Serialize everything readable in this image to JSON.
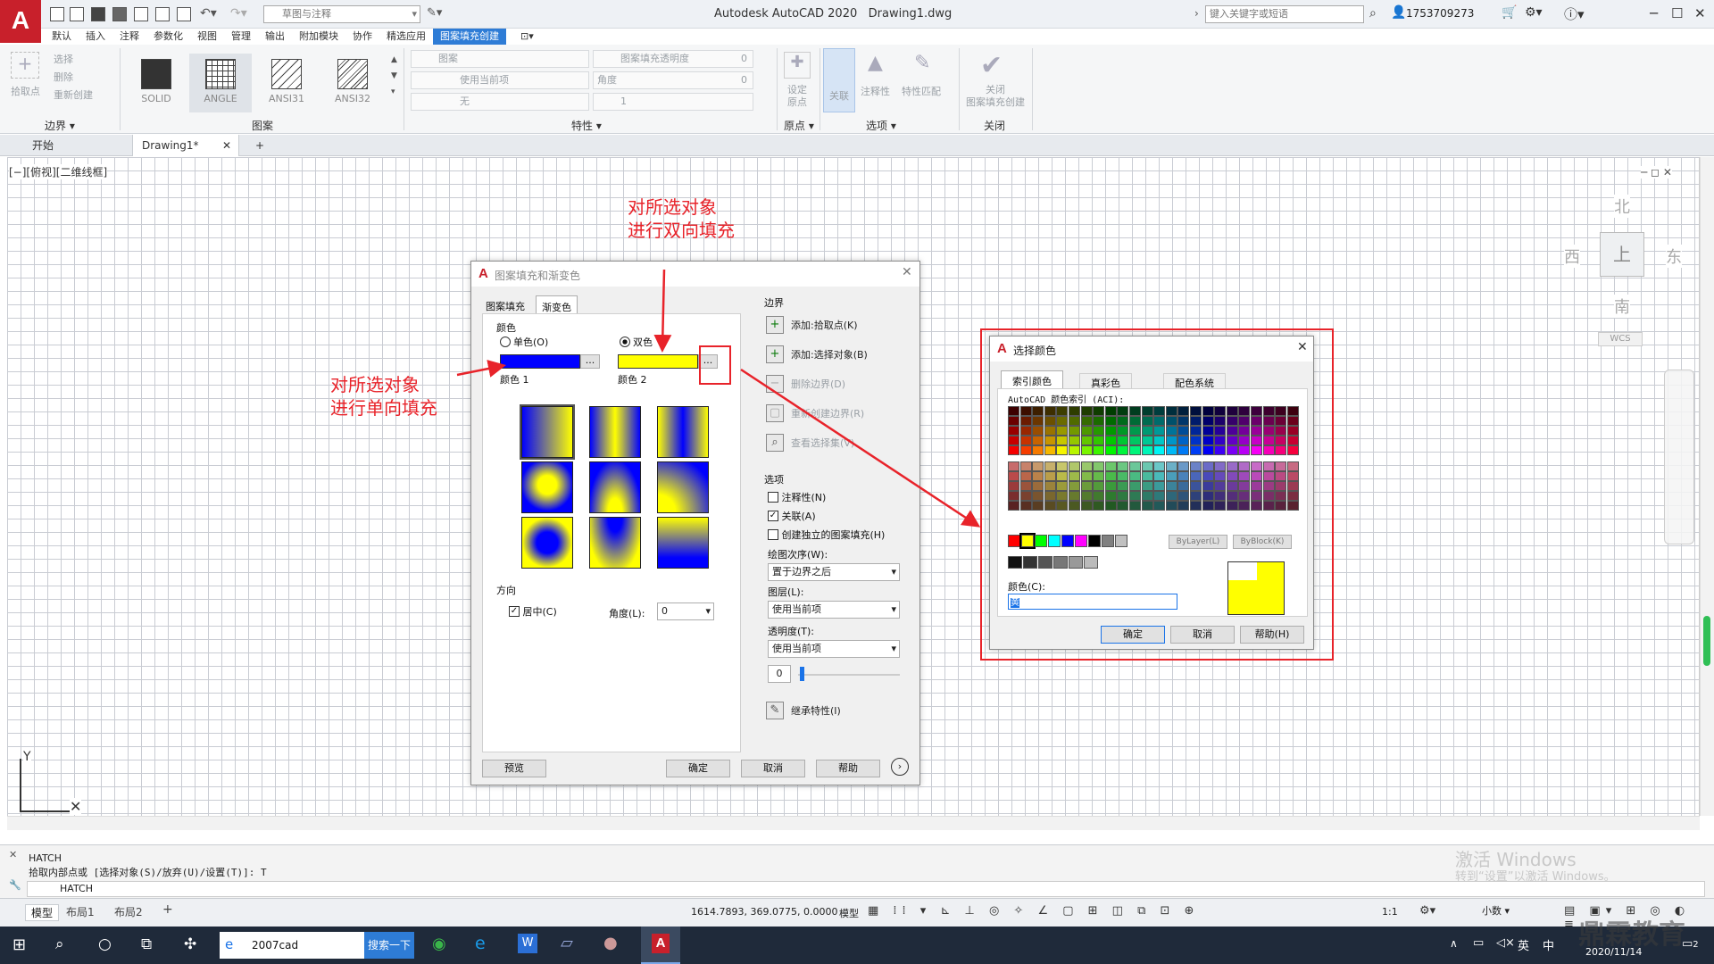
{
  "titlebar": {
    "logo": "A",
    "workspace": "草图与注释",
    "title": "Autodesk AutoCAD 2020",
    "document": "Drawing1.dwg",
    "search_placeholder": "键入关键字或短语",
    "user": "1753709273"
  },
  "menu_tabs": [
    "默认",
    "插入",
    "注释",
    "参数化",
    "视图",
    "管理",
    "输出",
    "附加模块",
    "协作",
    "精选应用",
    "图案填充创建"
  ],
  "ribbon": {
    "boundary": {
      "pick": "拾取点",
      "select": "选择",
      "remove": "删除",
      "recreate": "重新创建",
      "title": "边界"
    },
    "pattern": {
      "tiles": [
        "SOLID",
        "ANGLE",
        "ANSI31",
        "ANSI32"
      ],
      "title": "图案"
    },
    "properties": {
      "type": "图案",
      "transparency_label": "图案填充透明度",
      "transparency_value": "0",
      "color": "使用当前项",
      "angle_label": "角度",
      "angle_value": "0",
      "bg": "无",
      "scale_value": "1",
      "title": "特性"
    },
    "origin": {
      "set": "设定",
      "origin": "原点",
      "title": "原点"
    },
    "options": {
      "assoc": "关联",
      "annot": "注释性",
      "match": "特性匹配",
      "title": "选项"
    },
    "close": {
      "label1": "关闭",
      "label2": "图案填充创建",
      "title": "关闭"
    }
  },
  "doc_tabs": {
    "start": "开始",
    "drawing": "Drawing1*"
  },
  "viewport_label": "[−][俯视][二维线框]",
  "viewcube": {
    "north": "北",
    "south": "南",
    "east": "东",
    "west": "西",
    "top": "上",
    "wcs": "WCS"
  },
  "hatch_dialog": {
    "title": "图案填充和渐变色",
    "tab_hatch": "图案填充",
    "tab_gradient": "渐变色",
    "color_group": "颜色",
    "single": "单色(O)",
    "double": "双色",
    "color1_label": "颜色 1",
    "color2_label": "颜色 2",
    "color1": "#0000ff",
    "color2": "#ffff00",
    "browse": "...",
    "direction_group": "方向",
    "center": "居中(C)",
    "angle_label": "角度(L):",
    "angle_value": "0",
    "boundary_group": "边界",
    "add_pick": "添加:拾取点(K)",
    "add_select": "添加:选择对象(B)",
    "remove_boundary": "删除边界(D)",
    "recreate_boundary": "重新创建边界(R)",
    "view_selection": "查看选择集(V)",
    "options_group": "选项",
    "annotative": "注释性(N)",
    "associative": "关联(A)",
    "independent": "创建独立的图案填充(H)",
    "draw_order_label": "绘图次序(W):",
    "draw_order_value": "置于边界之后",
    "layer_label": "图层(L):",
    "layer_value": "使用当前项",
    "transparency_label": "透明度(T):",
    "transparency_value": "使用当前项",
    "transparency_number": "0",
    "inherit": "继承特性(I)",
    "preview": "预览",
    "ok": "确定",
    "cancel": "取消",
    "help": "帮助"
  },
  "color_dialog": {
    "title": "选择颜色",
    "tabs": [
      "索引颜色",
      "真彩色",
      "配色系统"
    ],
    "aci_label": "AutoCAD 颜色索引 (ACI):",
    "bylayer": "ByLayer(L)",
    "byblock": "ByBlock(K)",
    "color_label": "颜色(C):",
    "color_value": "黄",
    "selected_color": "#ffff00",
    "ok": "确定",
    "cancel": "取消",
    "help": "帮助(H)"
  },
  "annotations": {
    "top_line1": "对所选对象",
    "top_line2": "进行双向填充",
    "left_line1": "对所选对象",
    "left_line2": "进行单向填充"
  },
  "command": {
    "line1": "HATCH",
    "line2": "拾取内部点或 [选择对象(S)/放弃(U)/设置(T)]: T",
    "prompt": "HATCH"
  },
  "watermark": {
    "line1": "激活 Windows",
    "line2": "转到“设置”以激活 Windows。"
  },
  "status": {
    "layout_tabs": [
      "模型",
      "布局1",
      "布局2"
    ],
    "coords": "1614.7893, 369.0775, 0.0000",
    "model": "模型",
    "scale": "1:1",
    "units": "小数"
  },
  "taskbar": {
    "search_text": "2007cad",
    "search_button": "搜索一下",
    "ime": "英",
    "ime2": "中",
    "date": "2020/11/14",
    "notif": "2"
  },
  "brand_watermark": "鼎霖教育"
}
